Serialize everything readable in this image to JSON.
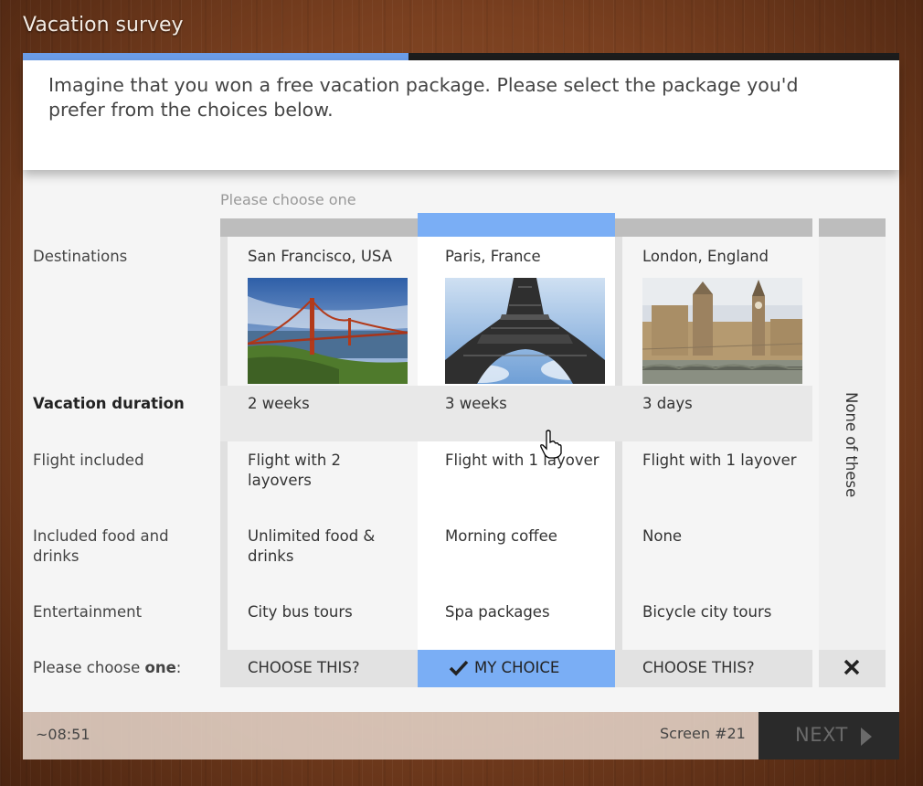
{
  "app": {
    "title": "Vacation survey"
  },
  "progress": {
    "fraction": 0.44
  },
  "question": {
    "text": "Imagine that you won a free vacation package. Please select the package you'd prefer from the choices below."
  },
  "hint": "Please choose one",
  "attributes": {
    "destinations": "Destinations",
    "duration": "Vacation duration",
    "flight": "Flight included",
    "food": "Included food and drinks",
    "entertainment": "Entertainment",
    "choose_prefix": "Please choose ",
    "choose_bold": "one",
    "choose_suffix": ":"
  },
  "options": [
    {
      "destination": "San Francisco, USA",
      "duration": "2 weeks",
      "flight": "Flight with 2 layovers",
      "food": "Unlimited food & drinks",
      "entertainment": "City bus tours",
      "button": "CHOOSE THIS?",
      "image_icon": "golden-gate-bridge-photo"
    },
    {
      "destination": "Paris, France",
      "duration": "3 weeks",
      "flight": "Flight with 1 layover",
      "food": "Morning coffee",
      "entertainment": "Spa packages",
      "button": "MY CHOICE",
      "selected": true,
      "image_icon": "eiffel-tower-photo"
    },
    {
      "destination": "London, England",
      "duration": "3 days",
      "flight": "Flight with 1 layover",
      "food": "None",
      "entertainment": "Bicycle city tours",
      "button": "CHOOSE THIS?",
      "image_icon": "westminster-palace-photo"
    }
  ],
  "none_option": {
    "label": "None of these",
    "icon": "close-x-icon"
  },
  "footer": {
    "timer": "~08:51",
    "screen": "Screen #21",
    "next": "NEXT"
  },
  "colors": {
    "accent": "#7aaef5",
    "progress": "#6b9de8",
    "next_bg": "#2a2a2a"
  }
}
